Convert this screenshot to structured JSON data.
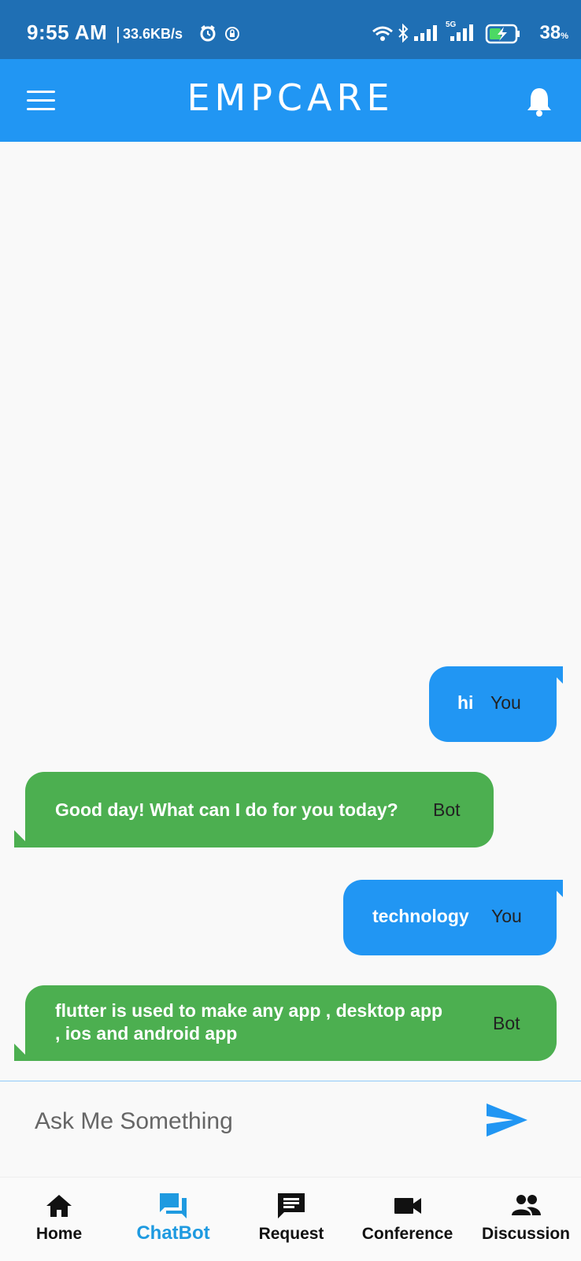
{
  "status_bar": {
    "time": "9:55 AM",
    "net_speed": "33.6KB/s",
    "battery": "38",
    "network": "5G",
    "icons": [
      "alarm-icon",
      "vpn-icon",
      "wifi-icon",
      "bluetooth-icon",
      "signal-icon",
      "battery-charging-icon"
    ]
  },
  "app_bar": {
    "title": "EMPCARE",
    "left_icon": "menu-icon",
    "right_icon": "bell-icon"
  },
  "chat": {
    "messages": [
      {
        "sender": "You",
        "text": "hi"
      },
      {
        "sender": "Bot",
        "text": "Good day! What can I do for you today?"
      },
      {
        "sender": "You",
        "text": "technology"
      },
      {
        "sender": "Bot",
        "text": "flutter is used to make any app , desktop app ,  ios and android app"
      }
    ]
  },
  "input": {
    "placeholder": "Ask Me Something",
    "value": "",
    "send_icon": "send-icon"
  },
  "bottom_nav": {
    "items": [
      {
        "label": "Home",
        "icon": "home-icon",
        "active": false
      },
      {
        "label": "ChatBot",
        "icon": "chat-icon",
        "active": true
      },
      {
        "label": "Request",
        "icon": "message-icon",
        "active": false
      },
      {
        "label": "Conference",
        "icon": "video-icon",
        "active": false
      },
      {
        "label": "Discussion",
        "icon": "group-icon",
        "active": false
      }
    ]
  },
  "colors": {
    "status_bar": "#1f6fb4",
    "primary": "#2196f3",
    "bot_bubble": "#4caf50",
    "active_nav": "#1e9ae0"
  }
}
